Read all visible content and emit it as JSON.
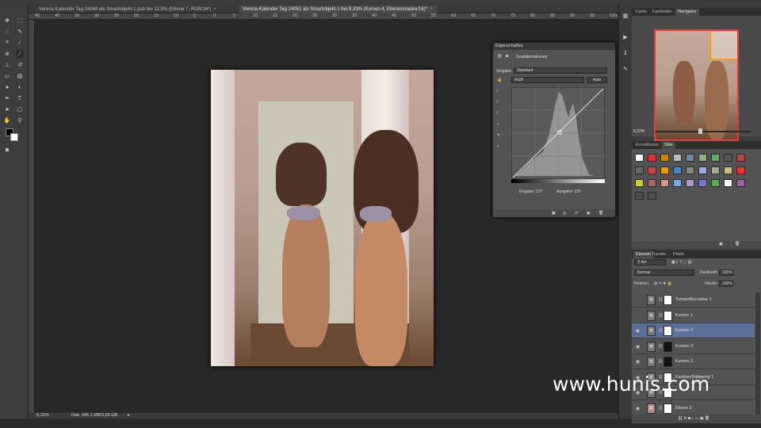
{
  "tabs": [
    {
      "label": "Verena Kalender Tag 24068 als Smartobjekt-1.psb bei 12,5% (Ebene 7, RGB/16*)",
      "close": "×"
    },
    {
      "label": "Verena Kalender Tag 24051 als Smartobjekt-1 bei 8,33% (Kurven 4, Ebenenmaske/16)*",
      "close": "×"
    }
  ],
  "ruler": [
    "45",
    "40",
    "35",
    "30",
    "25",
    "20",
    "15",
    "10",
    "5",
    "0",
    "5",
    "10",
    "15",
    "20",
    "25",
    "30",
    "35",
    "40",
    "45",
    "50",
    "55",
    "60",
    "65",
    "70",
    "75",
    "80",
    "85",
    "90",
    "95",
    "100"
  ],
  "status": {
    "zoom": "8,33%",
    "doc": "Dok: 346,1 MB/3,55 GB"
  },
  "properties": {
    "title": "Eigenschaften",
    "adjust": "Gradationskurven",
    "preset_label": "Vorgabe:",
    "preset_value": "Standard",
    "channel": "RGB",
    "auto": "Auto",
    "input_label": "Eingabe: 127",
    "output_label": "Ausgabe: 125"
  },
  "nav_panel": {
    "tabs": [
      "Farbe",
      "Farbfelder",
      "Navigator"
    ],
    "zoom": "8,33%"
  },
  "styles_panel": {
    "tabs": [
      "Korrekturen",
      "Stile"
    ]
  },
  "layers_panel": {
    "tabs": [
      "Ebenen",
      "Kanäle",
      "Pfade"
    ],
    "filter": "Art",
    "blend": "Normal",
    "opacity_label": "Deckkraft:",
    "opacity_value": "100%",
    "fixed_label": "Fixieren:",
    "fill_label": "Fläche:",
    "fill_value": "100%",
    "layers": [
      {
        "name": "Tonwertkorrektur 1",
        "visible": false,
        "selected": false
      },
      {
        "name": "Kurven 1",
        "visible": false,
        "selected": false
      },
      {
        "name": "Kurven 4",
        "visible": true,
        "selected": true
      },
      {
        "name": "Kurven 3",
        "visible": true,
        "selected": false
      },
      {
        "name": "Kurven 2",
        "visible": true,
        "selected": false
      },
      {
        "name": "Farbton/Sättigung 1",
        "visible": true,
        "selected": false
      },
      {
        "name": "",
        "visible": true,
        "selected": false
      },
      {
        "name": "Ebene 3",
        "visible": true,
        "selected": false
      }
    ]
  },
  "watermark": "www.hunis.com",
  "colors": {
    "accent": "#5c6f96",
    "nav_frame": "#e53b3b",
    "nav_highlight": "#f0a020"
  }
}
